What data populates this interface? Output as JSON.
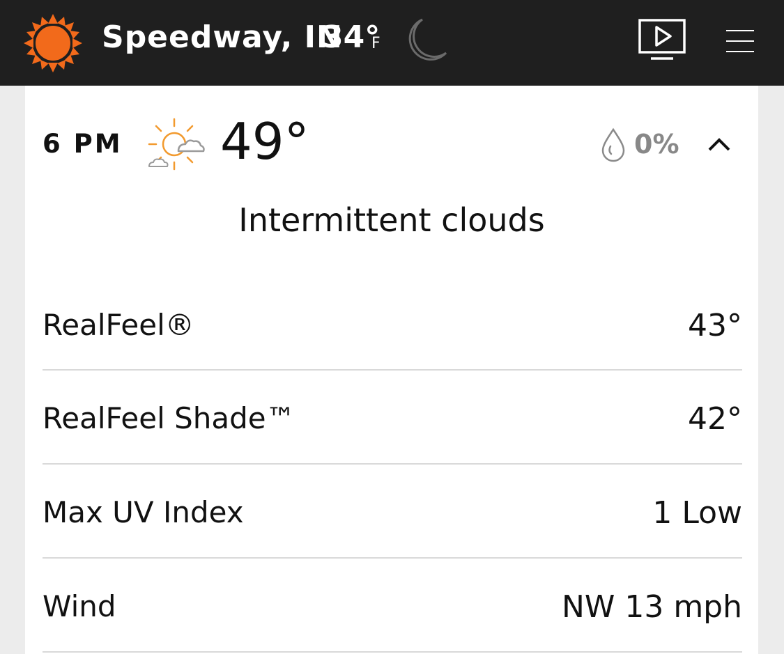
{
  "header": {
    "location": "Speedway, IN",
    "current_temp": "34°",
    "unit": "F",
    "icons": {
      "logo": "sun-logo-icon",
      "moon": "moon-icon",
      "video": "video-play-icon",
      "menu": "hamburger-menu-icon"
    },
    "colors": {
      "background": "#1f1f1f",
      "brand_orange": "#f26a1b"
    }
  },
  "forecast": {
    "hour": "6 PM",
    "condition_icon": "partly-sunny-icon",
    "temperature": "49°",
    "precip_icon": "raindrop-icon",
    "precip_probability": "0%",
    "toggle_icon": "chevron-up-icon",
    "phrase": "Intermittent clouds",
    "details": [
      {
        "label": "RealFeel®",
        "value": "43°"
      },
      {
        "label": "RealFeel Shade™",
        "value": "42°"
      },
      {
        "label": "Max UV Index",
        "value": "1 Low"
      },
      {
        "label": "Wind",
        "value": "NW 13 mph"
      }
    ]
  }
}
